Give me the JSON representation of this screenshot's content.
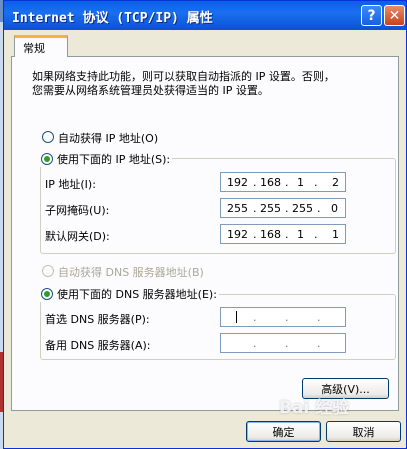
{
  "window": {
    "title": "Internet 协议 (TCP/IP) 属性",
    "help_glyph": "?",
    "close_glyph": "✕"
  },
  "tab": {
    "label": "常规"
  },
  "description": {
    "line1": "如果网络支持此功能，则可以获取自动指派的 IP 设置。否则，",
    "line2": "您需要从网络系统管理员处获得适当的 IP 设置。"
  },
  "ip_section": {
    "auto_label": "自动获得 IP 地址(O)",
    "manual_label": "使用下面的 IP 地址(S):",
    "selected": "manual",
    "fields": [
      {
        "label": "IP 地址(I):",
        "octets": [
          "192",
          "168",
          "1",
          "2"
        ]
      },
      {
        "label": "子网掩码(U):",
        "octets": [
          "255",
          "255",
          "255",
          "0"
        ]
      },
      {
        "label": "默认网关(D):",
        "octets": [
          "192",
          "168",
          "1",
          "1"
        ]
      }
    ]
  },
  "dns_section": {
    "auto_label": "自动获得 DNS 服务器地址(B)",
    "auto_disabled": true,
    "manual_label": "使用下面的 DNS 服务器地址(E):",
    "selected": "manual",
    "preferred_label": "首选 DNS 服务器(P):",
    "alternate_label": "备用 DNS 服务器(A):",
    "preferred_octets": [
      "",
      "",
      "",
      ""
    ],
    "alternate_octets": [
      "",
      "",
      "",
      ""
    ]
  },
  "buttons": {
    "advanced": "高级(V)...",
    "ok": "确定",
    "cancel": "取消"
  },
  "watermark": "Bai 经验"
}
